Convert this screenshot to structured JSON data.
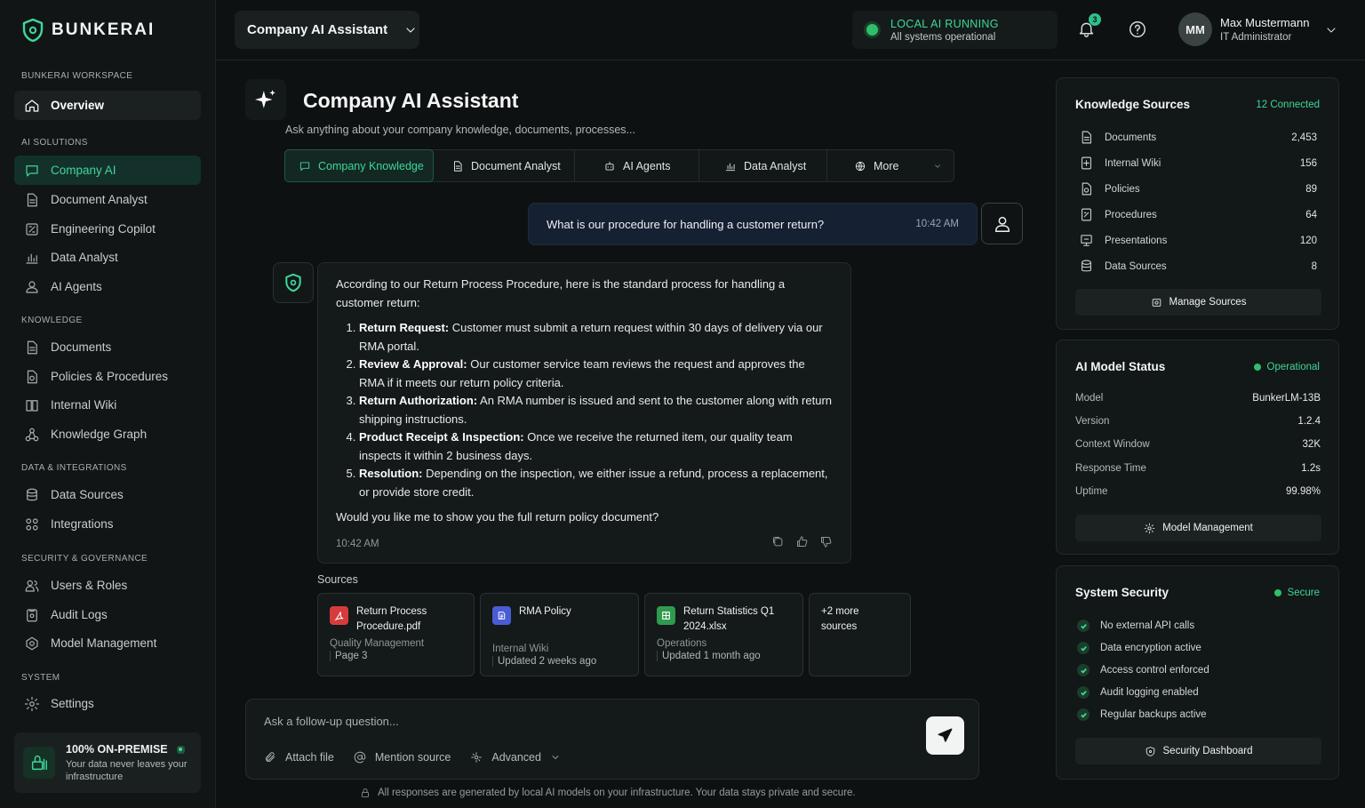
{
  "brand": {
    "name": "BUNKERAI"
  },
  "sidebar": {
    "workspace_label": "BUNKERAI WORKSPACE",
    "overview": "Overview",
    "sections": {
      "ai_solutions": "AI SOLUTIONS",
      "knowledge": "KNOWLEDGE",
      "data_integrations": "DATA & INTEGRATIONS",
      "security_governance": "SECURITY & GOVERNANCE",
      "system": "SYSTEM"
    },
    "ai_items": [
      "Company AI",
      "Document Analyst",
      "Engineering Copilot",
      "Data Analyst",
      "AI Agents"
    ],
    "knowledge_items": [
      "Documents",
      "Policies & Procedures",
      "Internal Wiki",
      "Knowledge Graph"
    ],
    "data_items": [
      "Data Sources",
      "Integrations"
    ],
    "security_items": [
      "Users & Roles",
      "Audit Logs",
      "Model Management"
    ],
    "system_items": [
      "Settings"
    ],
    "onprem": {
      "title": "100% ON-PREMISE",
      "subtitle": "Your data never leaves your infrastructure"
    }
  },
  "topbar": {
    "assistant_select": "Company AI Assistant",
    "status_title": "LOCAL AI RUNNING",
    "status_sub": "All systems operational",
    "notifications_count": "3",
    "user_initials": "MM",
    "user_name": "Max Mustermann",
    "user_role": "IT Administrator"
  },
  "main": {
    "title": "Company AI Assistant",
    "subtitle": "Ask anything about your company knowledge, documents, processes...",
    "tabs": [
      "Company Knowledge",
      "Document Analyst",
      "AI Agents",
      "Data Analyst",
      "More"
    ],
    "question": {
      "text": "What is our procedure for handling a customer return?",
      "time": "10:42 AM"
    },
    "answer": {
      "intro": "According to our Return Process Procedure, here is the standard process for handling a customer return:",
      "steps": [
        {
          "title": "Return Request:",
          "text": " Customer must submit a return request within 30 days of delivery via our RMA portal."
        },
        {
          "title": "Review & Approval:",
          "text": " Our customer service team reviews the request and approves the RMA if it meets our return policy criteria."
        },
        {
          "title": "Return Authorization:",
          "text": " An RMA number is issued and sent to the customer along with return shipping instructions."
        },
        {
          "title": "Product Receipt & Inspection:",
          "text": " Once we receive the returned item, our quality team inspects it within 2 business days."
        },
        {
          "title": "Resolution:",
          "text": " Depending on the inspection, we either issue a refund, process a replacement, or provide store credit."
        }
      ],
      "followup": "Would you like me to show you the full return policy document?",
      "time": "10:42 AM"
    },
    "sources_label": "Sources",
    "sources": [
      {
        "title": "Return Process Procedure.pdf",
        "category": "Quality Management",
        "meta": "Page 3",
        "color": "#d63c3c"
      },
      {
        "title": "RMA Policy",
        "category": "Internal Wiki",
        "meta": "Updated 2 weeks ago",
        "color": "#4a5bd6"
      },
      {
        "title": "Return Statistics Q1 2024.xlsx",
        "category": "Operations",
        "meta": "Updated 1 month ago",
        "color": "#2f9a4e"
      }
    ],
    "more_sources": "+2 more sources",
    "input_placeholder": "Ask a follow-up question...",
    "input_actions": {
      "attach": "Attach file",
      "mention": "Mention source",
      "advanced": "Advanced"
    },
    "footnote": "All responses are generated by local AI models on your infrastructure. Your data stays private and secure."
  },
  "knowledge_sources": {
    "title": "Knowledge Sources",
    "connected": "12 Connected",
    "rows": [
      {
        "label": "Documents",
        "value": "2,453",
        "icon": "document-icon"
      },
      {
        "label": "Internal Wiki",
        "value": "156",
        "icon": "wiki-icon"
      },
      {
        "label": "Policies",
        "value": "89",
        "icon": "policy-icon"
      },
      {
        "label": "Procedures",
        "value": "64",
        "icon": "procedure-icon"
      },
      {
        "label": "Presentations",
        "value": "120",
        "icon": "presentation-icon"
      },
      {
        "label": "Data Sources",
        "value": "8",
        "icon": "database-icon"
      }
    ],
    "button": "Manage Sources"
  },
  "model_status": {
    "title": "AI Model Status",
    "status": "Operational",
    "rows": [
      {
        "label": "Model",
        "value": "BunkerLM-13B"
      },
      {
        "label": "Version",
        "value": "1.2.4"
      },
      {
        "label": "Context Window",
        "value": "32K"
      },
      {
        "label": "Response Time",
        "value": "1.2s"
      },
      {
        "label": "Uptime",
        "value": "99.98%"
      }
    ],
    "button": "Model Management"
  },
  "system_security": {
    "title": "System Security",
    "status": "Secure",
    "rows": [
      "No external API calls",
      "Data encryption active",
      "Access control enforced",
      "Audit logging enabled",
      "Regular backups active"
    ],
    "button": "Security Dashboard"
  },
  "colors": {
    "accent": "#3ed79a",
    "background": "#0e1111",
    "panel": "#121717"
  }
}
